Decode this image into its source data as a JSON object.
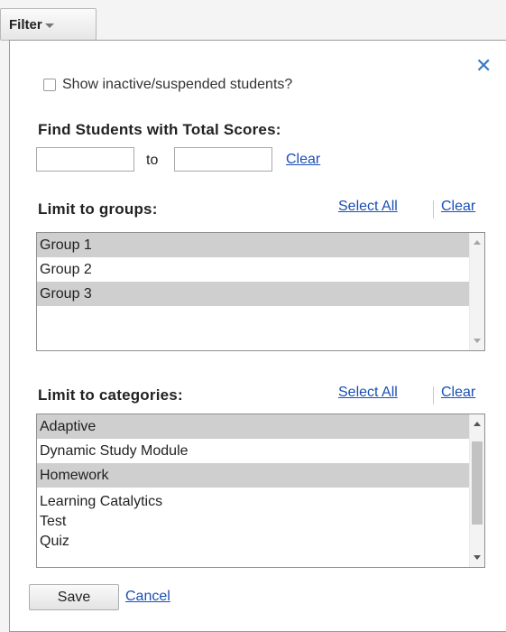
{
  "filter_button": {
    "label": "Filter"
  },
  "panel": {
    "show_inactive_label": "Show inactive/suspended students?",
    "scores": {
      "heading": "Find Students with Total Scores:",
      "from_value": "",
      "to_label": "to",
      "to_value": "",
      "clear_label": "Clear"
    },
    "groups": {
      "heading": "Limit to groups:",
      "select_all_label": "Select All",
      "clear_label": "Clear",
      "items": [
        {
          "label": "Group 1",
          "selected": true
        },
        {
          "label": "Group 2",
          "selected": false
        },
        {
          "label": "Group 3",
          "selected": true
        }
      ]
    },
    "categories": {
      "heading": "Limit to categories:",
      "select_all_label": "Select All",
      "clear_label": "Clear",
      "items": [
        {
          "label": "Adaptive",
          "selected": true
        },
        {
          "label": "Dynamic Study Module",
          "selected": false
        },
        {
          "label": "Homework",
          "selected": true
        },
        {
          "label": "Learning Catalytics",
          "selected": false
        },
        {
          "label": "Test",
          "selected": false
        },
        {
          "label": "Quiz",
          "selected": false
        }
      ]
    },
    "save_label": "Save",
    "cancel_label": "Cancel"
  },
  "icons": {
    "close": "close-icon",
    "caret": "caret-down-icon",
    "checkbox": "checkbox-icon"
  },
  "colors": {
    "link": "#1a4fb5",
    "close": "#3b78c2",
    "selected_row": "#cfcfcf"
  }
}
